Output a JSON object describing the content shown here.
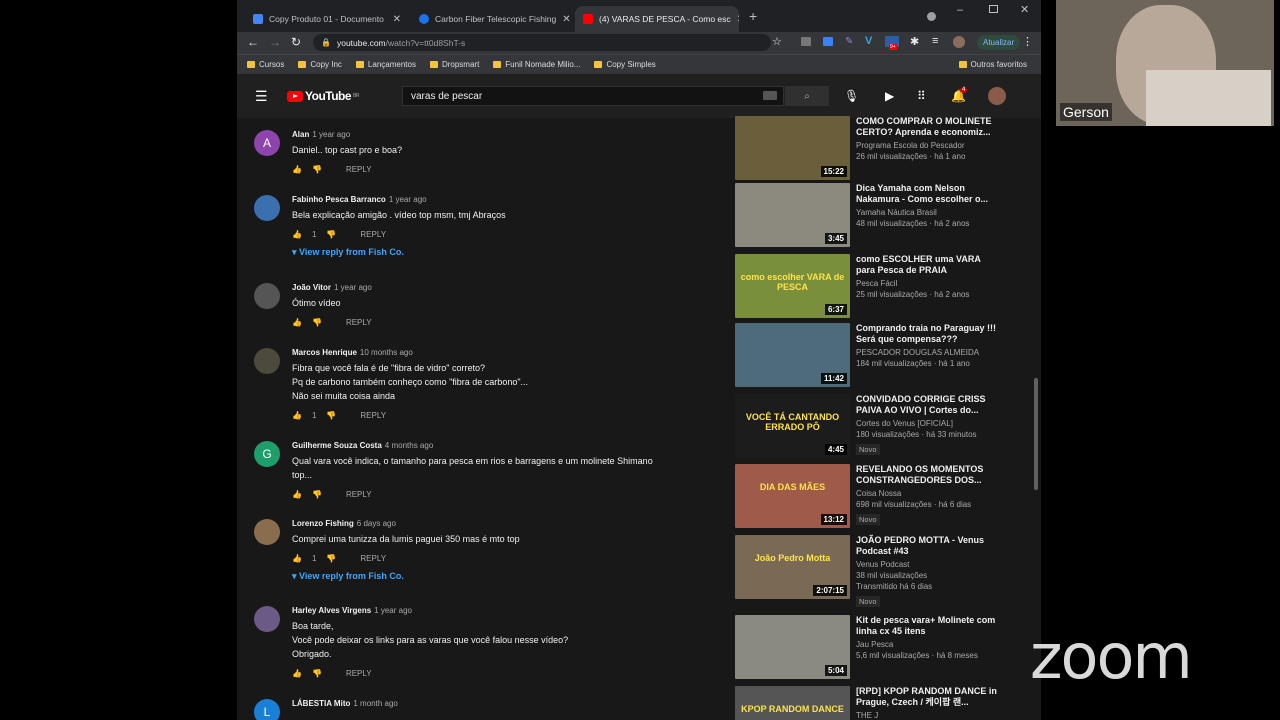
{
  "browser": {
    "tabs": [
      {
        "label": "Copy Produto 01 - Documento",
        "color": "#4285f4"
      },
      {
        "label": "Carbon Fiber Telescopic Fishing",
        "color": "#1a73e8"
      },
      {
        "label": "(4) VARAS DE PESCA - Como esc",
        "color": "#ff0000"
      }
    ],
    "close_glyph": "✕",
    "new_tab_glyph": "+",
    "url_host": "youtube.com",
    "url_path": "/watch?v=tt0d8ShT-s",
    "update_label": "Atualizar",
    "bookmarks": [
      "Cursos",
      "Copy Inc",
      "Lançamentos",
      "Dropsmart",
      "Funil Nomade Milio...",
      "Copy Simples"
    ],
    "other_bookmarks": "Outros favoritos",
    "notification_count": "9+"
  },
  "youtube": {
    "logo_text": "YouTube",
    "logo_region": "BR",
    "search_value": "varas de pescar",
    "bell_count": "4"
  },
  "comments": [
    {
      "author": "Alan",
      "time": "1 year ago",
      "text": "Daniel.. top cast pro e boa?",
      "likes": "",
      "avatar_letter": "A",
      "avatar_color": "#8e44ad"
    },
    {
      "author": "Fabinho Pesca Barranco",
      "time": "1 year ago",
      "text": "Bela explicação amigão . vídeo top msm, tmj Abraços",
      "likes": "1",
      "avatar_letter": "",
      "avatar_color": "#3a6fb0",
      "view_reply": "View reply from Fish Co."
    },
    {
      "author": "João Vitor",
      "time": "1 year ago",
      "text": "Ótimo vídeo",
      "likes": "",
      "avatar_letter": "",
      "avatar_color": "#555"
    },
    {
      "author": "Marcos Henrique",
      "time": "10 months ago",
      "text": "Fibra que você fala é de \"fibra de vidro\" correto?\nPq de carbono também conheço como \"fibra de carbono\"...\nNão sei muita coisa ainda",
      "likes": "1",
      "avatar_letter": "",
      "avatar_color": "#4b4a3c"
    },
    {
      "author": "Guilherme Souza Costa",
      "time": "4 months ago",
      "text": "Qual vara você indica, o tamanho para pesca em rios e barragens e um molinete Shimano\ntop...",
      "likes": "",
      "avatar_letter": "G",
      "avatar_color": "#1e9e6a"
    },
    {
      "author": "Lorenzo Fishing",
      "time": "6 days ago",
      "text": "Comprei uma tunizza da lumis paguei 350 mas é mto top",
      "likes": "1",
      "avatar_letter": "",
      "avatar_color": "#8a6d4f",
      "view_reply": "View reply from Fish Co."
    },
    {
      "author": "Harley Alves Virgens",
      "time": "1 year ago",
      "text": "Boa tarde,\nVocê pode deixar os links para as varas que você falou nesse vídeo?\nObrigado.",
      "likes": "",
      "avatar_letter": "",
      "avatar_color": "#6b5a86"
    },
    {
      "author": "LÁBESTIA Mito",
      "time": "1 month ago",
      "text": "",
      "likes": "",
      "avatar_letter": "L",
      "avatar_color": "#1b7fd6"
    }
  ],
  "reply_label": "REPLY",
  "videos": [
    {
      "title": "COMO COMPRAR O MOLINETE CERTO? Aprenda e economiz...",
      "channel": "Programa Escola do Pescador",
      "meta": "26 mil visualizações · há 1 ano",
      "duration": "15:22",
      "badge": "",
      "thumb": "#6b5f3b"
    },
    {
      "title": "Dica Yamaha com Nelson Nakamura - Como escolher o...",
      "channel": "Yamaha Náutica Brasil",
      "meta": "48 mil visualizações · há 2 anos",
      "duration": "3:45",
      "badge": "",
      "thumb": "#8c8a7e"
    },
    {
      "title": "como ESCOLHER uma VARA para Pesca de PRAIA",
      "channel": "Pesca Fácil",
      "meta": "25 mil visualizações · há 2 anos",
      "duration": "6:37",
      "badge": "",
      "thumb": "#7a8f3c",
      "overlay": "como escolher VARA de PESCA"
    },
    {
      "title": "Comprando traia no Paraguay !!! Será que compensa???",
      "channel": "PESCADOR DOUGLAS ALMEIDA",
      "meta": "184 mil visualizações · há 1 ano",
      "duration": "11:42",
      "badge": "",
      "thumb": "#4d6b7a"
    },
    {
      "title": "CONVIDADO CORRIGE CRISS PAIVA AO VIVO | Cortes do...",
      "channel": "Cortes do Venus [OFICIAL]",
      "meta": "180 visualizações · há 33 minutos",
      "duration": "4:45",
      "badge": "Novo",
      "thumb": "#1c1c1c",
      "overlay": "VOCÊ TÁ CANTANDO ERRADO PÔ"
    },
    {
      "title": "REVELANDO OS MOMENTOS CONSTRANGEDORES DOS...",
      "channel": "Coisa Nossa",
      "meta": "698 mil visualizações · há 6 dias",
      "duration": "13:12",
      "badge": "Novo",
      "thumb": "#a05a4a",
      "overlay": "DIA DAS MÃES"
    },
    {
      "title": "JOÃO PEDRO MOTTA - Venus Podcast #43",
      "channel": "Venus Podcast",
      "meta": "38 mil visualizações",
      "meta2": "Transmitido há 6 dias",
      "duration": "2:07:15",
      "badge": "Novo",
      "thumb": "#7a6a55",
      "overlay": "João Pedro Motta"
    },
    {
      "title": "Kit de pesca vara+ Molinete com linha cx 45 itens",
      "channel": "Jau Pesca",
      "meta": "5,6 mil visualizações · há 8 meses",
      "duration": "5:04",
      "badge": "",
      "thumb": "#8a8a80"
    },
    {
      "title": "[RPD] KPOP RANDOM DANCE in Prague, Czech / 케이팝 랜...",
      "channel": "THE J",
      "meta": "",
      "duration": "",
      "badge": "",
      "thumb": "#555",
      "overlay": "KPOP RANDOM DANCE"
    }
  ],
  "zoom": {
    "participant_name": "Gerson",
    "logo": "zoom"
  }
}
